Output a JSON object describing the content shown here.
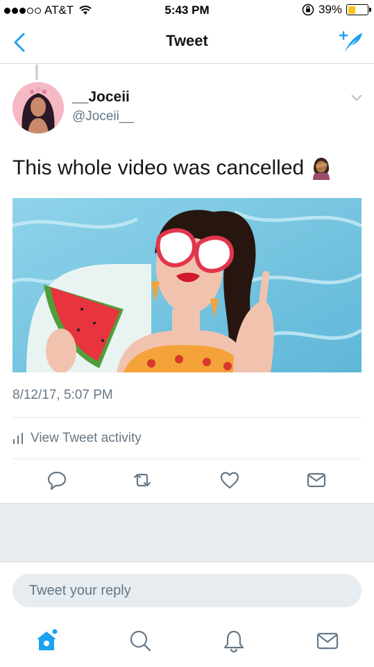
{
  "status_bar": {
    "carrier": "AT&T",
    "time": "5:43 PM",
    "battery_percent": "39%",
    "battery_level": 0.39
  },
  "nav": {
    "title": "Tweet"
  },
  "tweet": {
    "display_name": "__Joceii",
    "handle": "@Joceii__",
    "text": "This whole video was cancelled",
    "emoji": "🤦🏽‍♀️",
    "timestamp": "8/12/17, 5:07 PM",
    "activity_label": "View Tweet activity"
  },
  "reply": {
    "placeholder": "Tweet your reply"
  },
  "colors": {
    "accent": "#1da1f2",
    "secondary_text": "#657786",
    "icon_gray": "#657786",
    "battery_yellow": "#f5c518"
  },
  "icons": {
    "back": "chevron-left-icon",
    "compose": "compose-tweet-icon",
    "caret": "chevron-down-icon",
    "activity": "bar-chart-icon",
    "reply": "reply-icon",
    "retweet": "retweet-icon",
    "like": "heart-icon",
    "dm": "envelope-icon",
    "home": "home-icon",
    "search": "search-icon",
    "notifications": "bell-icon",
    "messages": "envelope-icon"
  }
}
